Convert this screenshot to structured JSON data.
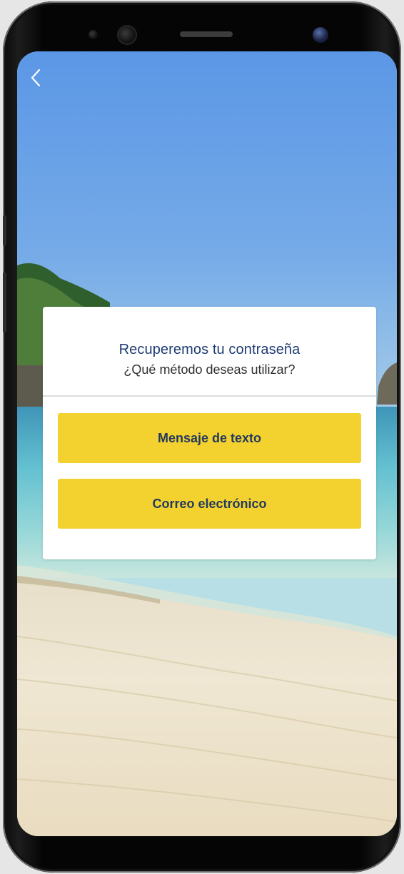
{
  "screen": {
    "back_icon": "chevron-left-icon"
  },
  "card": {
    "title": "Recuperemos tu contraseña",
    "subtitle": "¿Qué método deseas utilizar?",
    "options": [
      {
        "label": "Mensaje de texto"
      },
      {
        "label": "Correo electrónico"
      }
    ]
  },
  "colors": {
    "button_bg": "#f3d22f",
    "button_text": "#243a5e",
    "title_text": "#1e3c73",
    "sky": "#5f9ae6",
    "sea": "#6ec6d2",
    "sand": "#efe6d2"
  }
}
